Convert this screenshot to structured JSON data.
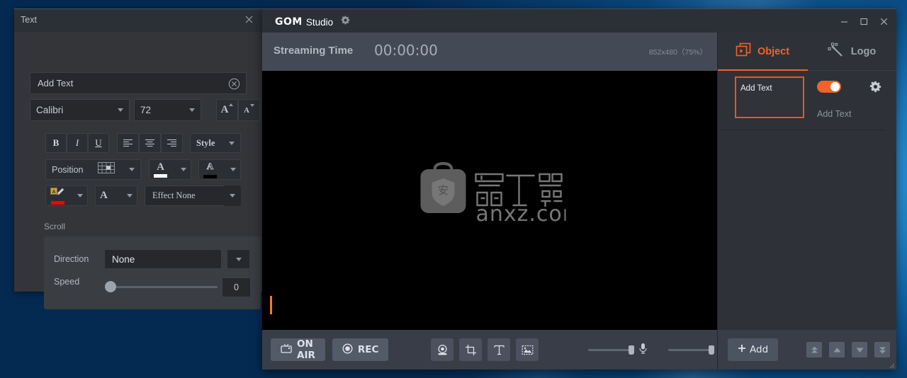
{
  "text_panel": {
    "title": "Text",
    "close_icon": "close-icon",
    "add_text_value": "Add Text",
    "add_text_placeholder": "Add Text",
    "clear_icon": "clear-circle-icon",
    "font_family": "Calibri",
    "font_size": "72",
    "grow_font_label": "A",
    "shrink_font_label": "A",
    "bold_label": "B",
    "italic_label": "I",
    "underline_label": "U",
    "align_left_icon": "align-left-icon",
    "align_center_icon": "align-center-icon",
    "align_right_icon": "align-right-icon",
    "style_label": "Style",
    "position_label": "Position",
    "position_grid_icon": "position-grid-icon",
    "text_color_label": "A",
    "text_color_swatch": "#ffffff",
    "outline_color_label": "A",
    "outline_color_swatch": "#000000",
    "highlight_icon": "highlight-pen-icon",
    "highlight_swatch": "#f40000",
    "shadow_label": "A",
    "effect_label": "Effect None",
    "scroll_section_label": "Scroll",
    "direction_label": "Direction",
    "direction_value": "None",
    "speed_label": "Speed",
    "speed_value": "0"
  },
  "gom_window": {
    "logo_text": "GOM",
    "logo_suffix": "Studio",
    "settings_icon": "gear-icon",
    "minimize_label": "–",
    "maximize_label": "□",
    "close_label": "✕"
  },
  "stream_bar": {
    "label": "Streaming Time",
    "time": "00:00:00",
    "resolution": "852x480（75%）"
  },
  "video": {
    "watermark_text": "anxz.com",
    "caret": "text-caret"
  },
  "bottom_bar": {
    "on_air_label": "ON AIR",
    "on_air_icon": "tv-icon",
    "rec_label": "REC",
    "rec_icon": "record-circle-icon",
    "tools": [
      {
        "name": "webcam-icon"
      },
      {
        "name": "crop-icon"
      },
      {
        "name": "text-tool-icon"
      },
      {
        "name": "image-icon"
      }
    ],
    "mic_icon": "microphone-icon",
    "speaker_icon": "speaker-icon"
  },
  "right_panel": {
    "tabs": [
      {
        "label": "Object",
        "icon": "object-layers-icon",
        "active": true
      },
      {
        "label": "Logo",
        "icon": "magic-wand-icon",
        "active": false
      }
    ],
    "object": {
      "thumb_label": "Add Text",
      "name": "Add Text",
      "toggle_on": true,
      "gear_icon": "gear-icon"
    },
    "add_label": "Add",
    "order_buttons": [
      {
        "name": "move-to-top-icon"
      },
      {
        "name": "move-up-icon"
      },
      {
        "name": "move-down-icon"
      },
      {
        "name": "move-to-bottom-icon"
      }
    ]
  },
  "colors": {
    "accent": "#f2622a",
    "panel_bg": "#2e3238",
    "toolbar_bg": "#383d47",
    "stream_bar_bg": "#444a55",
    "caret": "#f07c2a"
  }
}
